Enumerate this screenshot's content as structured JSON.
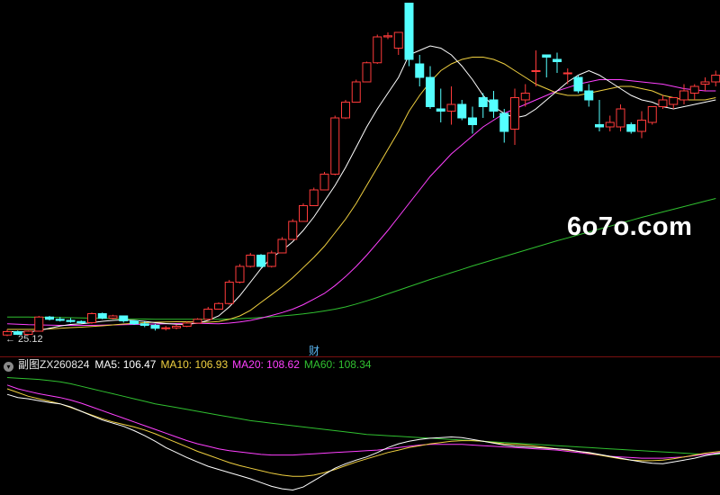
{
  "chart_data": {
    "type": "candlestick",
    "annotations": {
      "low_label": "← 25.12",
      "marker": "财"
    },
    "main_panel": {
      "ylim": [
        20,
        172
      ],
      "colors": {
        "up": "#ff3b3b",
        "down": "#54ffff",
        "ma5": "#ffffff",
        "ma10": "#f0d040",
        "ma20": "#ff40ff",
        "ma60": "#30c030"
      },
      "candles": [
        [
          25.5,
          28,
          25,
          27
        ],
        [
          27,
          27.5,
          25.5,
          25.8
        ],
        [
          25.8,
          27.5,
          25.5,
          27.2
        ],
        [
          27.2,
          34,
          27,
          33.5
        ],
        [
          33.5,
          34,
          32,
          32.5
        ],
        [
          32.5,
          33.5,
          31.5,
          32
        ],
        [
          32,
          33,
          31,
          31.5
        ],
        [
          31.5,
          32,
          30.5,
          31
        ],
        [
          31,
          35.5,
          30.5,
          35
        ],
        [
          35,
          35.5,
          32.5,
          33
        ],
        [
          33,
          34.5,
          32.5,
          34
        ],
        [
          34,
          34.2,
          31,
          31.8
        ],
        [
          31.8,
          32,
          30,
          30.5
        ],
        [
          30.5,
          31.5,
          29,
          29.8
        ],
        [
          29.8,
          30.5,
          27.5,
          28.5
        ],
        [
          28.5,
          29.5,
          27.5,
          28.7
        ],
        [
          28.7,
          30,
          28,
          29.4
        ],
        [
          29.4,
          31.5,
          29,
          30.8
        ],
        [
          30.8,
          33,
          30.5,
          32.5
        ],
        [
          32.5,
          38,
          32,
          37
        ],
        [
          37,
          40,
          36.8,
          39.5
        ],
        [
          39.5,
          50,
          39,
          49
        ],
        [
          49,
          57,
          48.5,
          56
        ],
        [
          56,
          62,
          55.5,
          61
        ],
        [
          61,
          61.5,
          55.5,
          56
        ],
        [
          56,
          63,
          55.5,
          62
        ],
        [
          62,
          69,
          61.8,
          68
        ],
        [
          68,
          77,
          67.8,
          76
        ],
        [
          76,
          84,
          75.8,
          83
        ],
        [
          83,
          91,
          82.8,
          90
        ],
        [
          90,
          98,
          89.8,
          97
        ],
        [
          97,
          123,
          96.5,
          122
        ],
        [
          122,
          130,
          121.5,
          129
        ],
        [
          129,
          139,
          128.8,
          138
        ],
        [
          138,
          147,
          137.8,
          146.5
        ],
        [
          146.5,
          159,
          146,
          158
        ],
        [
          158,
          160,
          157,
          158.5
        ],
        [
          153,
          160,
          150,
          160
        ],
        [
          173,
          173,
          145,
          148
        ],
        [
          146,
          150,
          136,
          140
        ],
        [
          140,
          145,
          126,
          127
        ],
        [
          126,
          135,
          120,
          125
        ],
        [
          125,
          136,
          119,
          128
        ],
        [
          128,
          130,
          121,
          122
        ],
        [
          122,
          127,
          115,
          119
        ],
        [
          131,
          133,
          122,
          127
        ],
        [
          130,
          134,
          122,
          125
        ],
        [
          124,
          126,
          111,
          116
        ],
        [
          117,
          135,
          110,
          131
        ],
        [
          130,
          137,
          127,
          133
        ],
        [
          143,
          152,
          136,
          143
        ],
        [
          150,
          150,
          140,
          149
        ],
        [
          148,
          151,
          142,
          147
        ],
        [
          142,
          144,
          137,
          142
        ],
        [
          140,
          141,
          133,
          134
        ],
        [
          134,
          137,
          127,
          130
        ],
        [
          119,
          130,
          116,
          118
        ],
        [
          118,
          123,
          116,
          120
        ],
        [
          118,
          128,
          116,
          126
        ],
        [
          119,
          120,
          115,
          116
        ],
        [
          116,
          125,
          113,
          121
        ],
        [
          120,
          127,
          119,
          127
        ],
        [
          127,
          132,
          126,
          130
        ],
        [
          128,
          131,
          126,
          131
        ],
        [
          130,
          137,
          128,
          134
        ],
        [
          133,
          137,
          130,
          136
        ],
        [
          137,
          140,
          134,
          138
        ],
        [
          138,
          143,
          136,
          141
        ]
      ],
      "ma5": [
        27,
        27,
        26.8,
        27.5,
        28.5,
        29.5,
        30.2,
        30.5,
        31,
        31.6,
        32,
        32.2,
        32,
        31.6,
        31,
        30.6,
        30.3,
        30.2,
        30.8,
        32,
        34,
        38,
        43,
        49,
        55,
        60,
        63,
        67,
        72,
        78,
        85,
        92,
        100,
        109,
        118,
        126,
        133,
        140,
        150,
        152,
        154,
        153,
        150,
        145,
        139,
        132,
        127,
        124,
        122,
        123,
        126,
        130,
        134,
        138,
        141,
        143,
        141,
        138,
        135,
        132,
        130,
        129,
        127,
        126,
        127,
        128,
        129,
        130
      ],
      "ma10": [
        28,
        28,
        28,
        28,
        28.2,
        28.5,
        28.8,
        29,
        29.3,
        29.6,
        30,
        30.4,
        30.7,
        31,
        31.2,
        31.3,
        31.4,
        31.4,
        31.3,
        31.2,
        31.5,
        32.5,
        34,
        36.5,
        40,
        43.5,
        47,
        51,
        55.5,
        60,
        65,
        71,
        77,
        84,
        92,
        100,
        108,
        116,
        125,
        132,
        138,
        143,
        146,
        148,
        149,
        149,
        148,
        146,
        143,
        140,
        137,
        135,
        133,
        132,
        132,
        133,
        134,
        135,
        136,
        136,
        135,
        134,
        132,
        131,
        130,
        130,
        130,
        131
      ],
      "ma20": [
        30.5,
        30.3,
        30.1,
        30,
        29.9,
        29.8,
        29.8,
        29.8,
        29.8,
        29.9,
        30,
        30.1,
        30.2,
        30.3,
        30.4,
        30.5,
        30.6,
        30.7,
        30.7,
        30.6,
        30.5,
        30.8,
        31.3,
        32,
        33,
        34.2,
        35.5,
        37,
        39,
        41.5,
        44,
        47.5,
        51.5,
        56,
        61,
        66.5,
        72,
        78,
        84,
        90,
        96,
        101,
        106,
        110,
        114,
        118,
        121,
        124,
        126,
        128,
        130,
        132,
        134,
        135.5,
        137,
        138,
        139,
        139,
        139,
        138.5,
        138,
        137.5,
        137,
        136,
        135,
        134.5,
        134,
        134
      ],
      "ma60": [
        33.5,
        33.5,
        33.5,
        33.4,
        33.4,
        33.3,
        33.2,
        33.1,
        33,
        32.9,
        32.8,
        32.7,
        32.6,
        32.6,
        32.5,
        32.5,
        32.5,
        32.5,
        32.5,
        32.5,
        32.5,
        32.6,
        32.8,
        33,
        33.3,
        33.6,
        34,
        34.4,
        34.9,
        35.5,
        36.2,
        37,
        38,
        39.3,
        40.7,
        42.2,
        43.8,
        45.4,
        47,
        48.6,
        50.2,
        51.7,
        53.2,
        54.7,
        56.2,
        57.6,
        59,
        60.4,
        61.8,
        63.2,
        64.6,
        66,
        67.4,
        68.7,
        70,
        71.3,
        72.6,
        73.9,
        75.2,
        76.5,
        77.8,
        79,
        80.2,
        81.4,
        82.6,
        83.8,
        85,
        86.2
      ]
    },
    "sub_panel": {
      "title": "副图ZX260824",
      "labels": [
        {
          "key": "ma5",
          "text": "MA5: 106.47",
          "color": "#ffffff"
        },
        {
          "key": "ma10",
          "text": "MA10: 106.93",
          "color": "#f0d040"
        },
        {
          "key": "ma20",
          "text": "MA20: 108.62",
          "color": "#ff40ff"
        },
        {
          "key": "ma60",
          "text": "MA60: 108.34",
          "color": "#30c030"
        }
      ],
      "ylim": [
        99.5,
        118.5
      ],
      "ma5": [
        115.3,
        114.8,
        114.6,
        114.3,
        114.0,
        113.8,
        113.3,
        112.6,
        111.9,
        111.2,
        110.7,
        110.2,
        109.5,
        108.7,
        107.8,
        106.8,
        106.0,
        105.2,
        104.5,
        103.8,
        103.3,
        102.8,
        102.3,
        101.8,
        101.2,
        100.6,
        100.2,
        100.0,
        100.5,
        101.5,
        102.5,
        103.5,
        104.2,
        104.8,
        105.3,
        106.0,
        106.8,
        107.4,
        107.8,
        108.1,
        108.3,
        108.4,
        108.5,
        108.4,
        108.1,
        107.8,
        107.5,
        107.2,
        107.0,
        106.9,
        106.8,
        106.7,
        106.6,
        106.5,
        106.2,
        106.0,
        105.7,
        105.4,
        105.1,
        104.8,
        104.5,
        104.3,
        104.2,
        104.5,
        104.8,
        105.1,
        105.5,
        105.8,
        106.0,
        106.1
      ],
      "ma10": [
        116.2,
        115.6,
        115.0,
        114.6,
        114.2,
        113.8,
        113.2,
        112.6,
        112.0,
        111.4,
        110.9,
        110.5,
        110.1,
        109.6,
        109.0,
        108.3,
        107.6,
        106.9,
        106.2,
        105.6,
        105.0,
        104.4,
        103.9,
        103.5,
        103.1,
        102.7,
        102.4,
        102.2,
        102.2,
        102.4,
        102.8,
        103.3,
        103.9,
        104.5,
        105.0,
        105.5,
        106.0,
        106.4,
        106.8,
        107.1,
        107.4,
        107.6,
        107.8,
        107.9,
        107.9,
        107.8,
        107.6,
        107.4,
        107.3,
        107.2,
        107.0,
        106.8,
        106.6,
        106.4,
        106.2,
        105.9,
        105.6,
        105.3,
        105.0,
        104.8,
        104.7,
        104.7,
        104.8,
        105.0,
        105.3,
        105.6,
        105.9,
        106.1,
        106.3,
        106.4
      ],
      "ma20": [
        116.8,
        116.2,
        115.8,
        115.4,
        115.1,
        114.8,
        114.4,
        113.9,
        113.3,
        112.7,
        112.1,
        111.5,
        110.9,
        110.3,
        109.7,
        109.1,
        108.5,
        107.9,
        107.4,
        107.0,
        106.6,
        106.3,
        106.1,
        105.9,
        105.7,
        105.6,
        105.6,
        105.6,
        105.7,
        105.8,
        105.9,
        106.0,
        106.1,
        106.2,
        106.3,
        106.4,
        106.6,
        106.8,
        107.0,
        107.2,
        107.3,
        107.3,
        107.3,
        107.3,
        107.2,
        107.1,
        107.0,
        106.9,
        106.8,
        106.7,
        106.6,
        106.5,
        106.4,
        106.2,
        106.0,
        105.8,
        105.6,
        105.4,
        105.3,
        105.2,
        105.1,
        105.1,
        105.1,
        105.2,
        105.3,
        105.5,
        105.7,
        105.9,
        106.1,
        106.3
      ],
      "ma60": [
        118.0,
        117.9,
        117.8,
        117.7,
        117.5,
        117.3,
        117.0,
        116.6,
        116.2,
        115.8,
        115.4,
        115.0,
        114.6,
        114.2,
        113.8,
        113.5,
        113.2,
        112.9,
        112.6,
        112.3,
        112.0,
        111.7,
        111.4,
        111.1,
        110.9,
        110.7,
        110.5,
        110.3,
        110.1,
        109.9,
        109.7,
        109.5,
        109.3,
        109.1,
        108.9,
        108.8,
        108.7,
        108.6,
        108.5,
        108.4,
        108.3,
        108.2,
        108.1,
        108.0,
        107.9,
        107.8,
        107.7,
        107.6,
        107.5,
        107.4,
        107.3,
        107.2,
        107.1,
        107.0,
        106.9,
        106.8,
        106.7,
        106.6,
        106.5,
        106.4,
        106.3,
        106.2,
        106.1,
        106.0,
        105.9,
        105.8,
        105.7,
        105.7,
        105.8,
        106.2
      ]
    }
  },
  "watermark": "6o7o.com",
  "icons": {
    "collapse": "chevron-down-icon"
  }
}
